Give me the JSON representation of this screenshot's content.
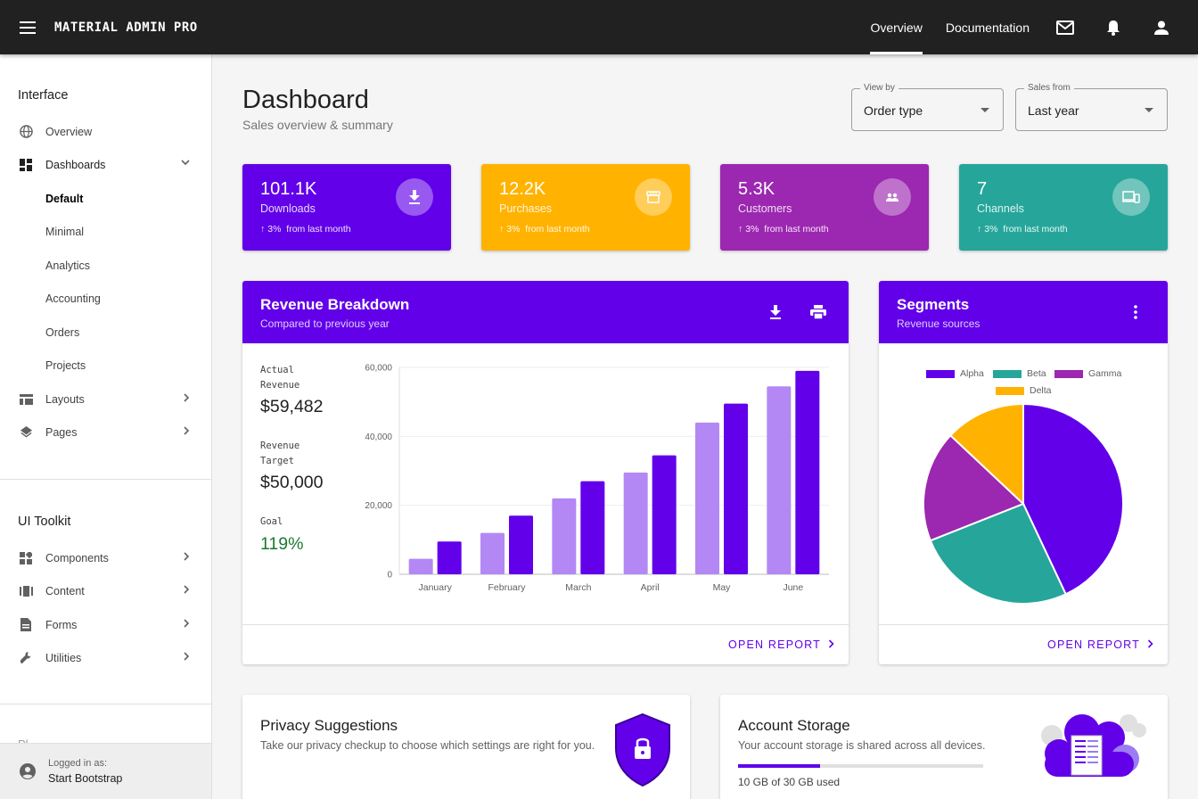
{
  "app": {
    "brand": "MATERIAL ADMIN PRO"
  },
  "topnav": {
    "links": [
      "Overview",
      "Documentation"
    ],
    "active": "Overview"
  },
  "sidebar": {
    "sections": [
      "Interface",
      "UI Toolkit"
    ],
    "interface_items": [
      {
        "label": "Overview",
        "icon": "globe-icon"
      },
      {
        "label": "Dashboards",
        "icon": "dashboard-icon"
      },
      {
        "label": "Layouts",
        "icon": "layout-icon"
      },
      {
        "label": "Pages",
        "icon": "layers-icon"
      }
    ],
    "dashboard_sub": [
      "Default",
      "Minimal",
      "Analytics",
      "Accounting",
      "Orders",
      "Projects"
    ],
    "toolkit_items": [
      {
        "label": "Components",
        "icon": "widgets-icon"
      },
      {
        "label": "Content",
        "icon": "content-icon"
      },
      {
        "label": "Forms",
        "icon": "form-icon"
      },
      {
        "label": "Utilities",
        "icon": "wrench-icon"
      }
    ],
    "partial_heading": "Pl",
    "footer": {
      "label": "Logged in as:",
      "user": "Start Bootstrap"
    }
  },
  "page": {
    "title": "Dashboard",
    "subtitle": "Sales overview & summary"
  },
  "filters": [
    {
      "label": "View by",
      "value": "Order type"
    },
    {
      "label": "Sales from",
      "value": "Last year"
    }
  ],
  "stats": [
    {
      "value": "101.1K",
      "label": "Downloads",
      "trend": "3%",
      "trend_text": "from last month",
      "color": "#6200ea",
      "icon": "download-icon"
    },
    {
      "value": "12.2K",
      "label": "Purchases",
      "trend": "3%",
      "trend_text": "from last month",
      "color": "#ffb300",
      "icon": "storefront-icon"
    },
    {
      "value": "5.3K",
      "label": "Customers",
      "trend": "3%",
      "trend_text": "from last month",
      "color": "#9c27b0",
      "icon": "people-icon"
    },
    {
      "value": "7",
      "label": "Channels",
      "trend": "3%",
      "trend_text": "from last month",
      "color": "#26a69a",
      "icon": "devices-icon"
    }
  ],
  "revenue": {
    "title": "Revenue Breakdown",
    "subtitle": "Compared to previous year",
    "metrics": [
      {
        "label": "Actual Revenue",
        "value": "$59,482"
      },
      {
        "label": "Revenue Target",
        "value": "$50,000"
      },
      {
        "label": "Goal",
        "value": "119%"
      }
    ],
    "link": "OPEN REPORT"
  },
  "segments": {
    "title": "Segments",
    "subtitle": "Revenue sources",
    "link": "OPEN REPORT"
  },
  "privacy": {
    "title": "Privacy Suggestions",
    "text": "Take our privacy checkup to choose which settings are right for you."
  },
  "storage": {
    "title": "Account Storage",
    "text": "Your account storage is shared across all devices.",
    "used_text": "10 GB of 30 GB used",
    "fraction": 0.333
  },
  "chart_data": [
    {
      "type": "bar",
      "categories": [
        "January",
        "February",
        "March",
        "April",
        "May",
        "June"
      ],
      "series": [
        {
          "values": [
            4500,
            12000,
            22000,
            29500,
            44000,
            54500
          ],
          "color": "#b388f5"
        },
        {
          "values": [
            9500,
            17000,
            27000,
            34500,
            49500,
            59000
          ],
          "color": "#6200ea"
        }
      ],
      "ylim": [
        0,
        60000
      ],
      "yticks": [
        "0",
        "20,000",
        "40,000",
        "60,000"
      ],
      "ytick_values": [
        0,
        20000,
        40000,
        60000
      ],
      "grid": true
    },
    {
      "type": "pie",
      "labels": [
        "Alpha",
        "Beta",
        "Gamma",
        "Delta"
      ],
      "values": [
        43,
        26,
        18,
        13
      ],
      "colors": [
        "#6200ea",
        "#26a69a",
        "#9c27b0",
        "#ffb300"
      ],
      "legend": "top"
    }
  ]
}
